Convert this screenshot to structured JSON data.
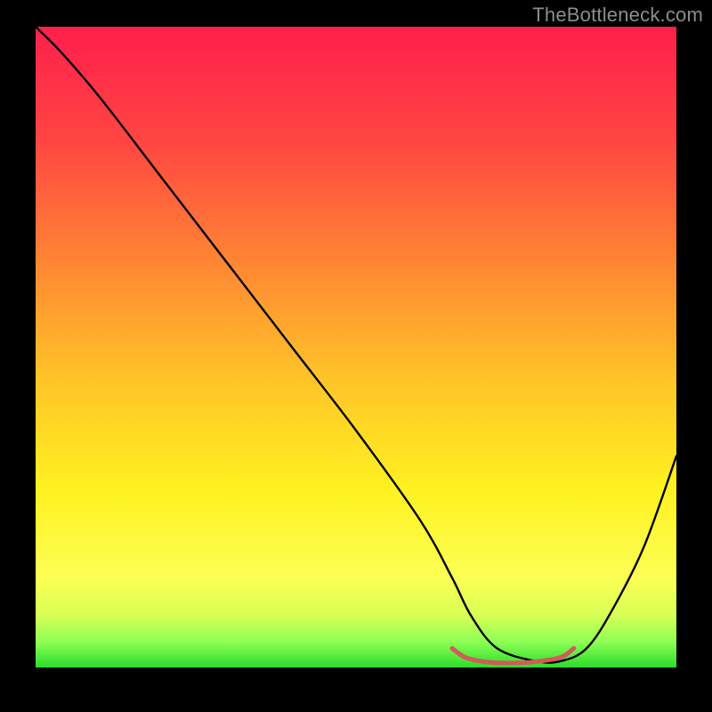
{
  "watermark": "TheBottleneck.com",
  "chart_data": {
    "type": "line",
    "title": "",
    "xlabel": "",
    "ylabel": "",
    "xlim": [
      0,
      100
    ],
    "ylim": [
      0,
      100
    ],
    "grid": false,
    "legend": false,
    "background_gradient": {
      "orientation": "vertical",
      "stops": [
        {
          "offset": 0.0,
          "color": "#ff1f4b"
        },
        {
          "offset": 0.18,
          "color": "#ff4642"
        },
        {
          "offset": 0.38,
          "color": "#ff8a33"
        },
        {
          "offset": 0.55,
          "color": "#ffc428"
        },
        {
          "offset": 0.72,
          "color": "#fff120"
        },
        {
          "offset": 0.86,
          "color": "#fcff55"
        },
        {
          "offset": 0.92,
          "color": "#d6ff55"
        },
        {
          "offset": 0.96,
          "color": "#8dff55"
        },
        {
          "offset": 1.0,
          "color": "#2bdc2b"
        }
      ]
    },
    "series": [
      {
        "name": "bottleneck-curve",
        "color": "#000000",
        "x": [
          0,
          4,
          10,
          20,
          30,
          40,
          50,
          60,
          65,
          68,
          72,
          78,
          82,
          86,
          90,
          95,
          100
        ],
        "y": [
          100,
          96,
          89,
          76,
          63,
          50,
          37,
          23,
          14,
          8,
          3,
          1,
          1,
          3,
          9,
          19,
          33
        ]
      },
      {
        "name": "optimal-band-marker",
        "color": "#d25a5a",
        "stroke_width": 5,
        "x": [
          65,
          67,
          70,
          74,
          78,
          82,
          84
        ],
        "y": [
          3.0,
          1.6,
          0.9,
          0.7,
          0.9,
          1.6,
          3.0
        ]
      }
    ],
    "annotations": []
  }
}
